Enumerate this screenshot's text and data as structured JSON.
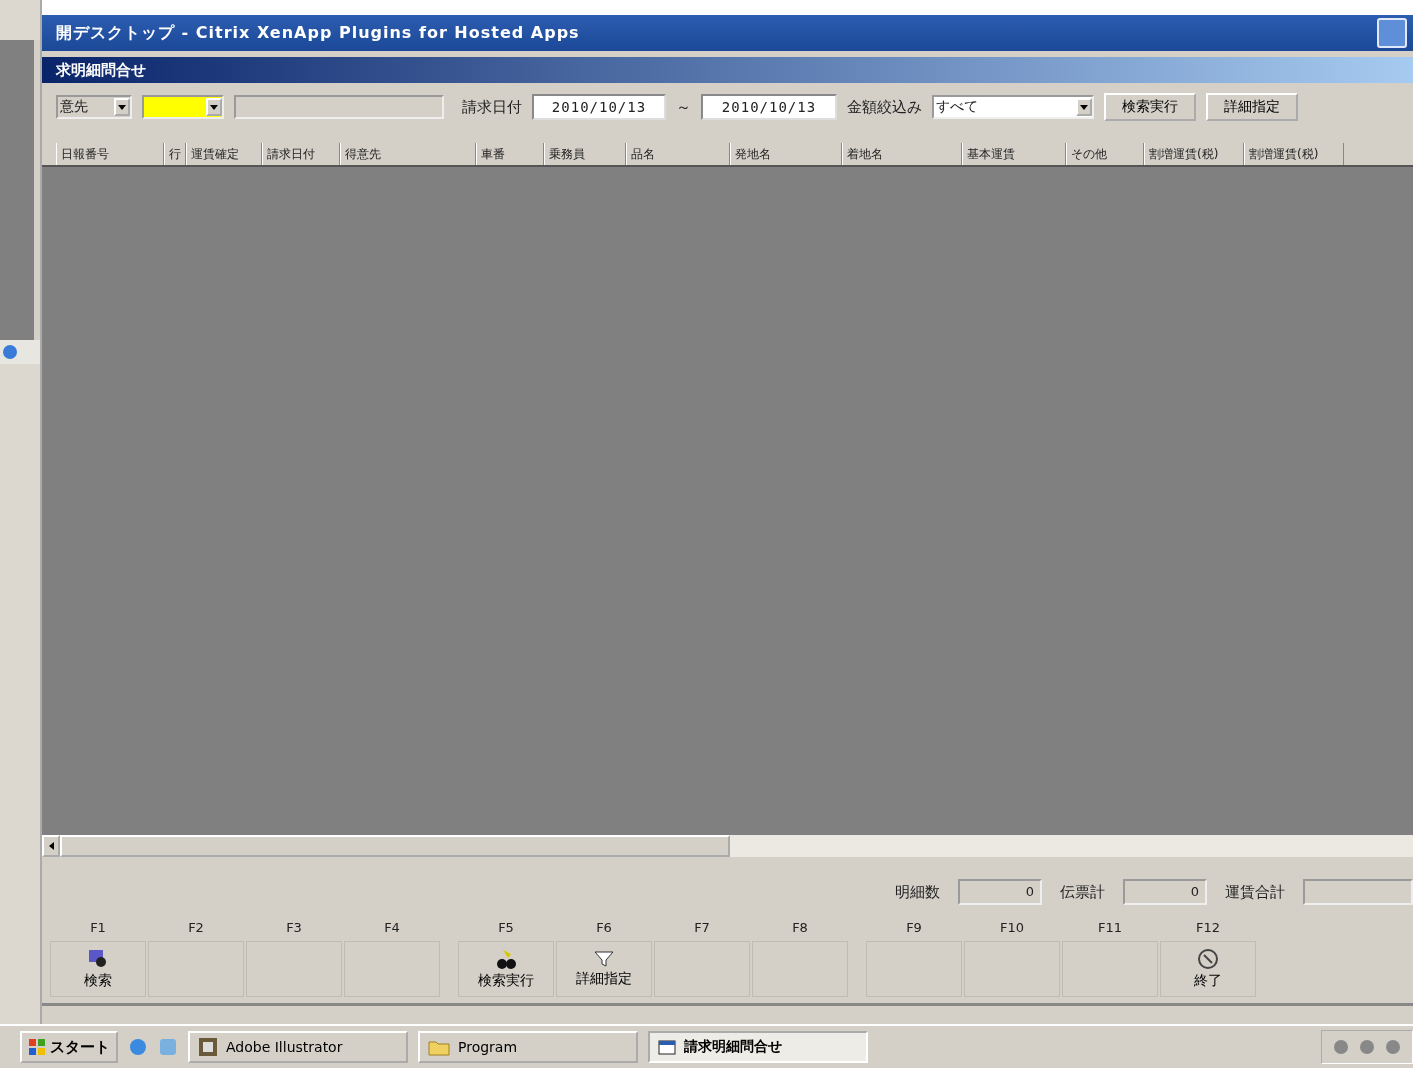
{
  "window": {
    "title": "開デスクトップ - Citrix XenApp Plugins for Hosted Apps"
  },
  "form": {
    "title": "求明細問合せ"
  },
  "filter": {
    "customer_label": "意先",
    "date_label": "請求日付",
    "date_from": "2010/10/13",
    "tilde": "～",
    "date_to": "2010/10/13",
    "amount_label": "金額絞込み",
    "amount_value": "すべて",
    "buttons": [
      "検索実行",
      "詳細指定"
    ]
  },
  "table": {
    "columns": [
      "日報番号",
      "行",
      "運賃確定",
      "請求日付",
      "得意先",
      "車番",
      "乗務員",
      "品名",
      "発地名",
      "着地名",
      "基本運賃",
      "その他",
      "割増運賃(税)",
      "割増運賃(税)"
    ]
  },
  "totals": [
    {
      "label": "明細数",
      "value": "0"
    },
    {
      "label": "伝票計",
      "value": "0"
    },
    {
      "label": "運賃合計"
    }
  ],
  "function_keys": [
    {
      "key": "F1",
      "label": "検索"
    },
    {
      "key": "F2"
    },
    {
      "key": "F3"
    },
    {
      "key": "F4"
    },
    {
      "key": "F5",
      "label": "検索実行"
    },
    {
      "key": "F6",
      "label": "詳細指定"
    },
    {
      "key": "F7"
    },
    {
      "key": "F8"
    },
    {
      "key": "F9"
    },
    {
      "key": "F10"
    },
    {
      "key": "F11"
    },
    {
      "key": "F12",
      "label": "終了"
    }
  ],
  "taskbar": {
    "start": "スタート",
    "tasks": [
      {
        "label": "Adobe Illustrator",
        "selected": false
      },
      {
        "label": "Program",
        "selected": false
      },
      {
        "label": "請求明細問合せ",
        "selected": true
      }
    ]
  }
}
